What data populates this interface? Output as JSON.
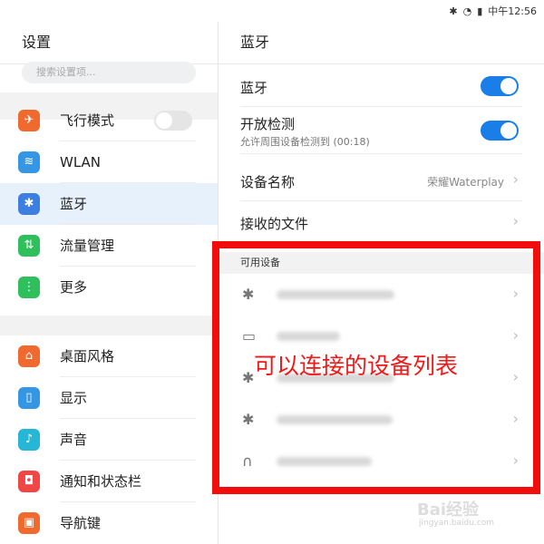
{
  "status_bar": {
    "time": "中午12:56"
  },
  "left": {
    "title": "设置",
    "search_placeholder": "搜索设置项...",
    "group1": [
      {
        "label": "飞行模式",
        "icon": "airplane-icon",
        "color": "#f06a2f",
        "toggle": "off"
      },
      {
        "label": "WLAN",
        "icon": "wifi-icon",
        "color": "#3596e3"
      },
      {
        "label": "蓝牙",
        "icon": "bluetooth-icon",
        "color": "#3d7fe0",
        "active": true
      },
      {
        "label": "流量管理",
        "icon": "data-usage-icon",
        "color": "#2fbf5c"
      },
      {
        "label": "更多",
        "icon": "more-icon",
        "color": "#2fbf5c"
      }
    ],
    "group2": [
      {
        "label": "桌面风格",
        "icon": "home-icon",
        "color": "#f06a2f"
      },
      {
        "label": "显示",
        "icon": "display-icon",
        "color": "#3596e3"
      },
      {
        "label": "声音",
        "icon": "sound-icon",
        "color": "#26b6d6"
      },
      {
        "label": "通知和状态栏",
        "icon": "notification-icon",
        "color": "#f04646"
      },
      {
        "label": "导航键",
        "icon": "navigation-icon",
        "color": "#f06a2f"
      }
    ]
  },
  "right": {
    "title": "蓝牙",
    "bluetooth_label": "蓝牙",
    "bluetooth_toggle": "on",
    "discoverable_label": "开放检测",
    "discoverable_sub": "允许周围设备检测到 (00:18)",
    "discoverable_toggle": "on",
    "device_name_label": "设备名称",
    "device_name_value": "荣耀Waterplay",
    "received_files_label": "接收的文件",
    "available_section": "可用设备",
    "devices": [
      {
        "icon": "bluetooth-icon",
        "glyph": "✱"
      },
      {
        "icon": "laptop-icon",
        "glyph": "▭"
      },
      {
        "icon": "bluetooth-icon",
        "glyph": "✱"
      },
      {
        "icon": "bluetooth-icon",
        "glyph": "✱"
      },
      {
        "icon": "headphones-icon",
        "glyph": "∩"
      }
    ]
  },
  "annotation": "可以连接的设备列表",
  "watermark": {
    "brand": "Bai经验",
    "url": "jingyan.baidu.com"
  },
  "colors": {
    "accent": "#1a7ee8",
    "annotation_red": "#f20d0d"
  }
}
